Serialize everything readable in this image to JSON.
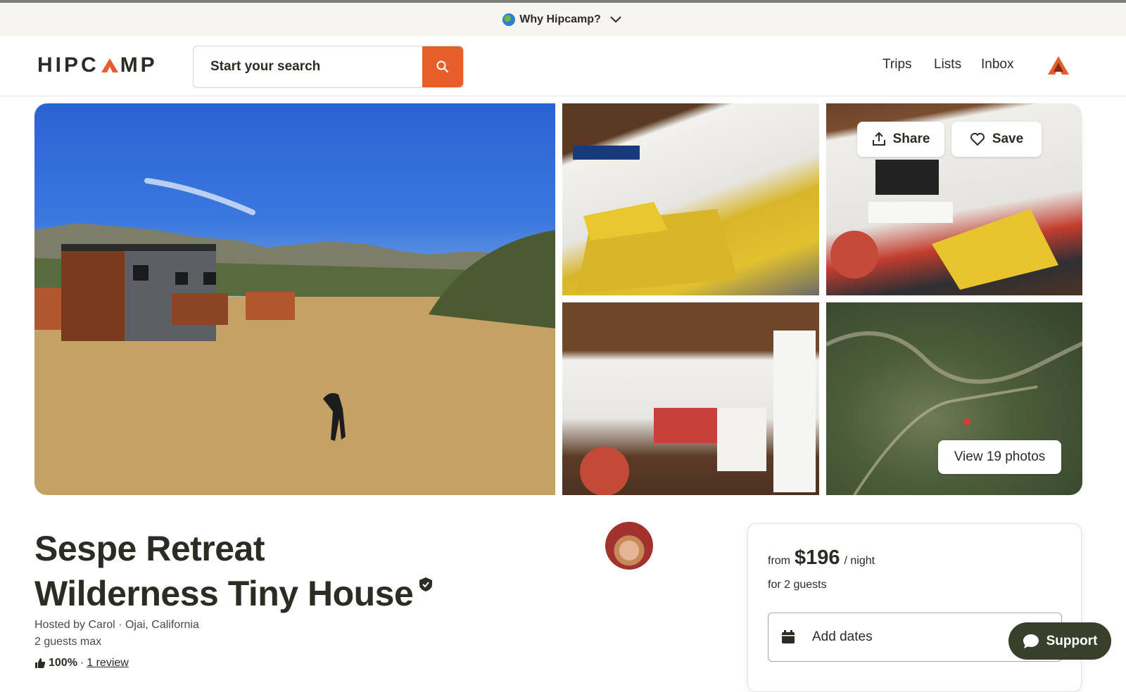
{
  "promo_bar": {
    "label": "Why Hipcamp?",
    "icon": "globe-icon"
  },
  "header": {
    "logo": {
      "before": "HIPC",
      "after": "MP"
    },
    "search": {
      "placeholder": "Start your search"
    },
    "nav": [
      "Trips",
      "Lists",
      "Inbox"
    ],
    "accent_color": "#e65f2b"
  },
  "gallery": {
    "share_label": "Share",
    "save_label": "Save",
    "view_photos_label": "View 19 photos"
  },
  "listing": {
    "title_line1": "Sespe Retreat",
    "title_line2": "Wilderness Tiny House",
    "host_line": "Hosted by Carol · Ojai, California",
    "guests_line": "2 guests max",
    "rating_percent": "100%",
    "rating_sep": "·",
    "reviews_label": "1 review"
  },
  "booking": {
    "from_label": "from",
    "price": "$196",
    "per_label": "/ night",
    "guests_label": "for 2 guests",
    "dates_label": "Add dates"
  },
  "support": {
    "label": "Support"
  }
}
